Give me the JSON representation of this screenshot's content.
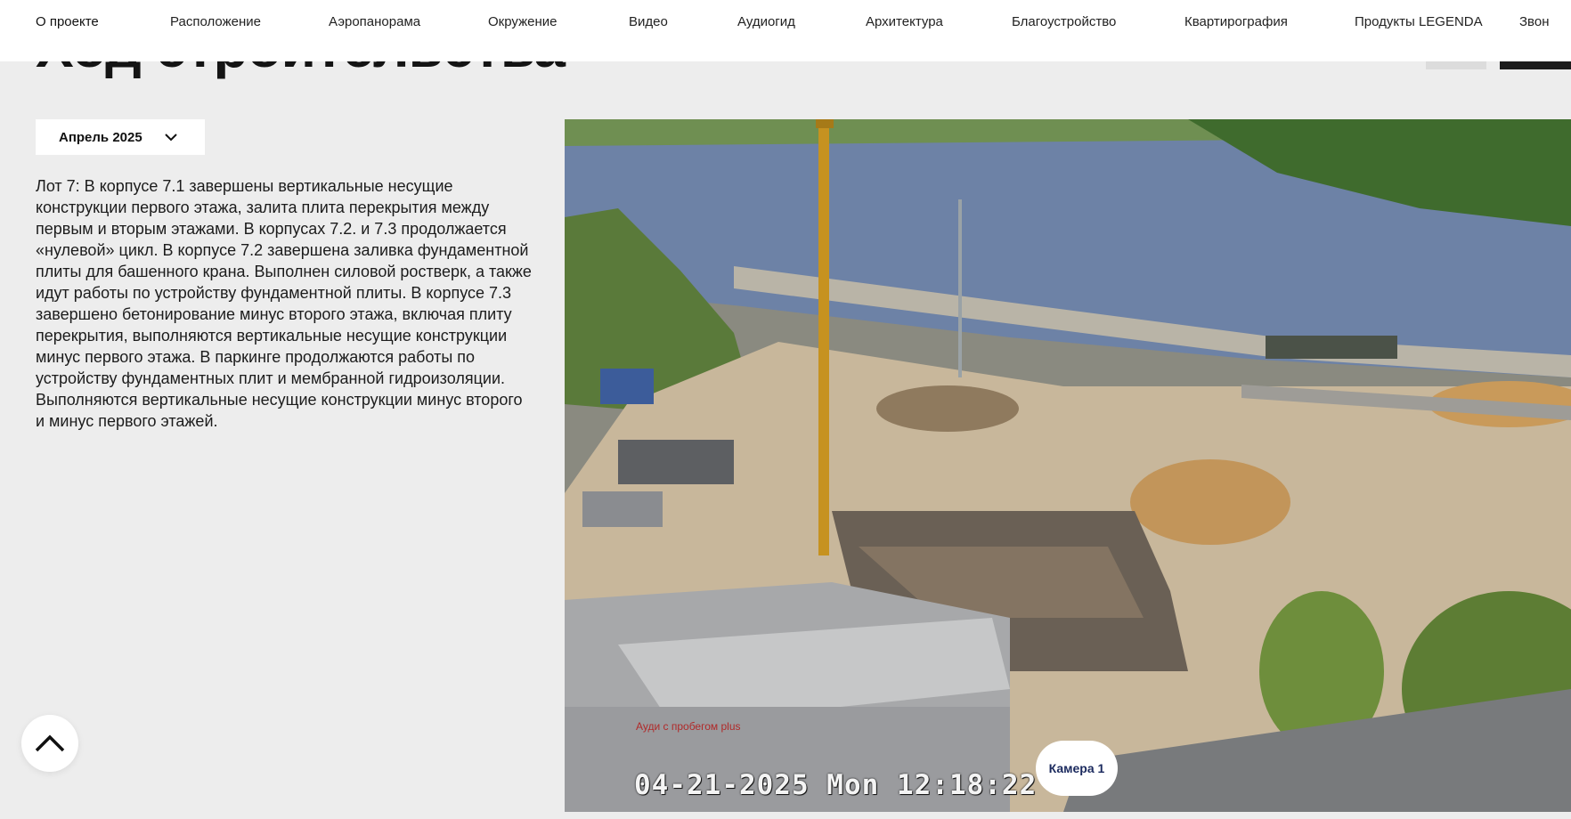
{
  "nav": {
    "items": [
      {
        "label": "О проекте"
      },
      {
        "label": "Расположение"
      },
      {
        "label": "Аэропанорама"
      },
      {
        "label": "Окружение"
      },
      {
        "label": "Видео"
      },
      {
        "label": "Аудиогид"
      },
      {
        "label": "Архитектура"
      },
      {
        "label": "Благоустройство"
      },
      {
        "label": "Квартирография"
      },
      {
        "label": "Продукты LEGENDA"
      },
      {
        "label": "Звон"
      }
    ]
  },
  "page": {
    "title": "Ход строительства"
  },
  "month_selector": {
    "value": "Апрель 2025",
    "icon": "chevron-down-icon"
  },
  "description": "Лот 7: В корпусе 7.1 завершены вертикальные несущие конструкции первого этажа, залита плита перекрытия между первым и вторым этажами. В корпусах 7.2. и 7.3 продолжается «нулевой» цикл. В корпусе 7.2 завершена заливка фундаментной плиты для башенного крана. Выполнен силовой ростверк, а также идут работы по устройству фундаментной плиты. В корпусе 7.3 завершено бетонирование минус второго этажа, включая плиту перекрытия, выполняются вертикальные несущие конструкции минус первого этажа. В паркинге продолжаются работы по устройству фундаментных плит и мембранной гидроизоляции. Выполняются вертикальные несущие конструкции минус второго и минус первого этажей.",
  "camera": {
    "timestamp": "04-21-2025 Mon 12:18:22",
    "badge_label": "Камера 1",
    "building_sign": "Ауди с пробегом plus"
  },
  "scroll_top": {
    "icon": "chevron-up-icon"
  },
  "colors": {
    "background": "#ededed",
    "nav_bg": "#ffffff",
    "badge_text": "#1b2a5e",
    "dark_button": "#1c1c1c"
  }
}
